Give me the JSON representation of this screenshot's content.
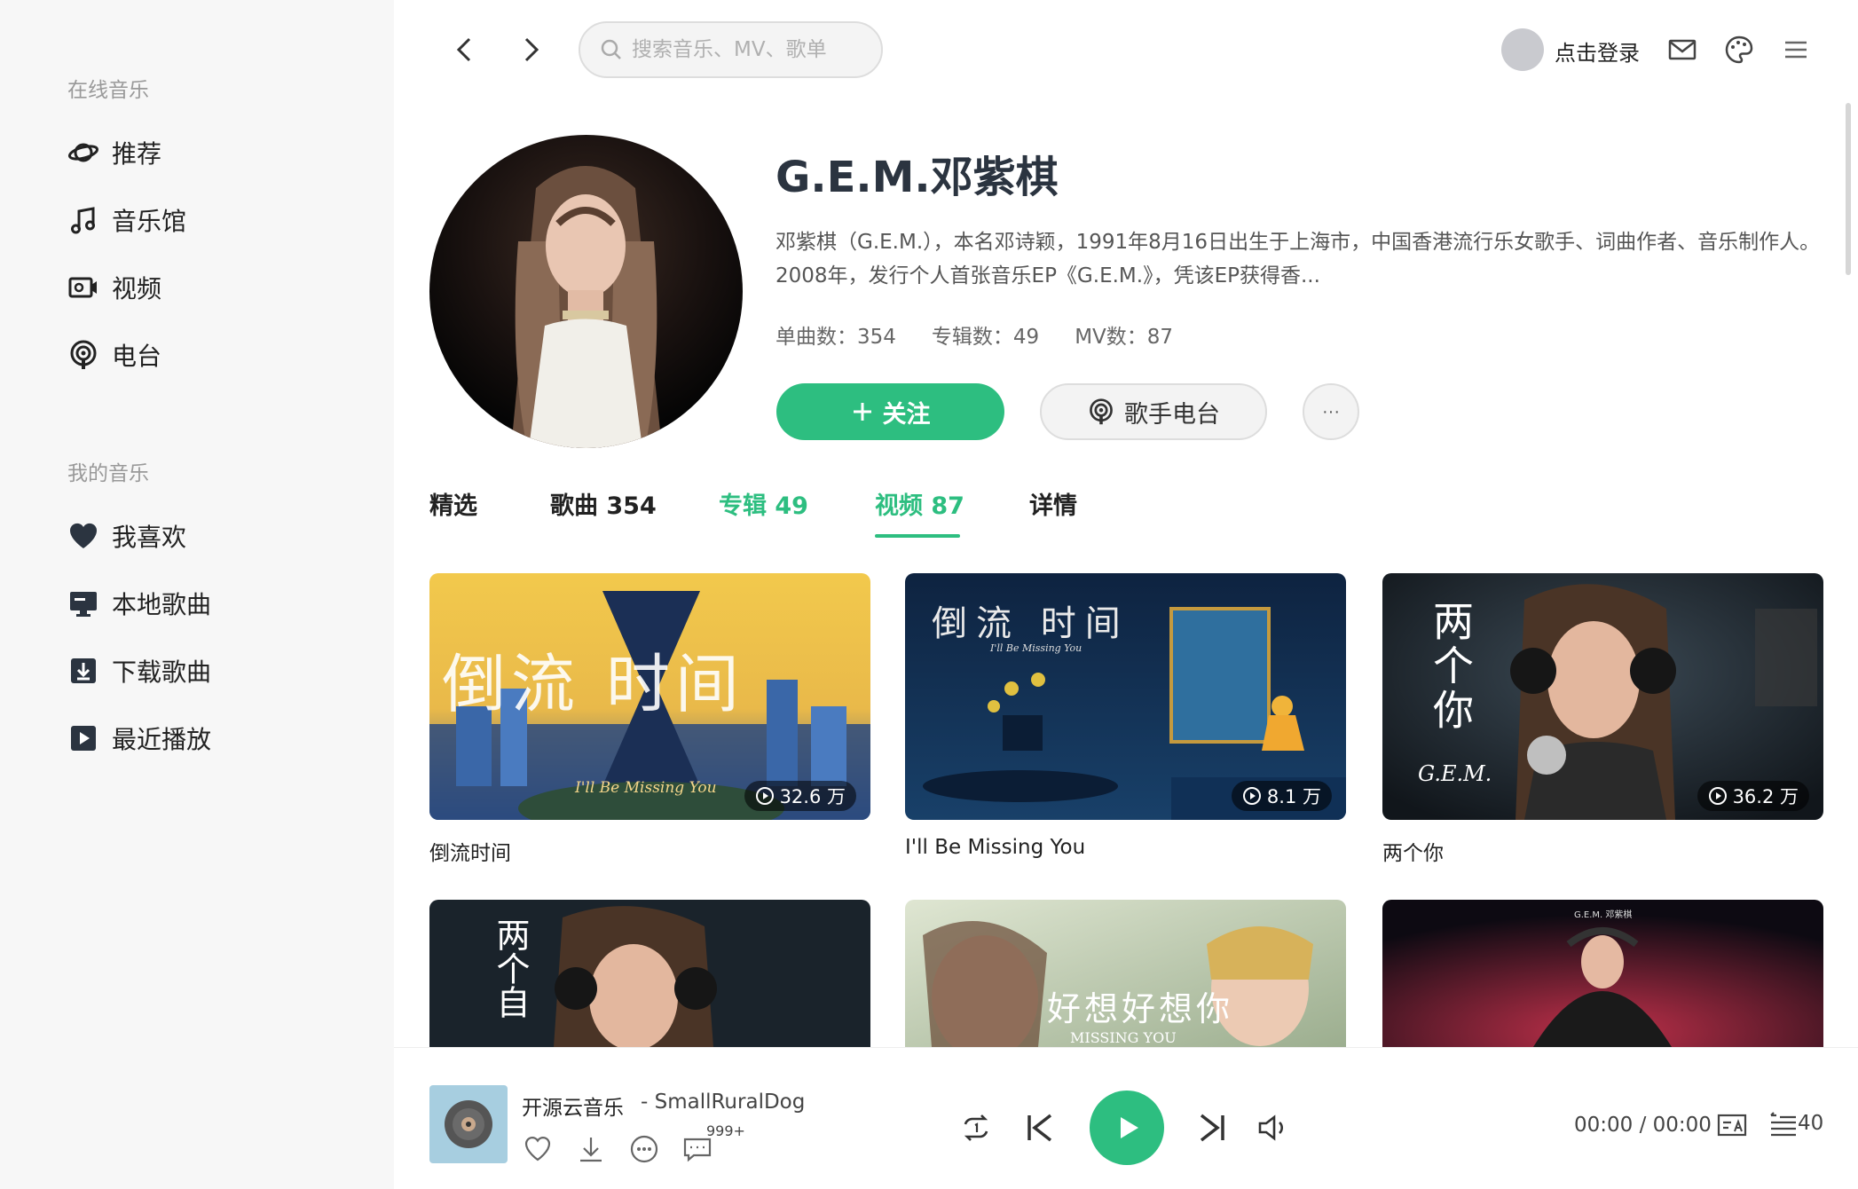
{
  "sidebar": {
    "online_section": "在线音乐",
    "online_items": [
      {
        "label": "推荐",
        "icon": "planet-icon"
      },
      {
        "label": "音乐馆",
        "icon": "music-note-icon"
      },
      {
        "label": "视频",
        "icon": "video-icon"
      },
      {
        "label": "电台",
        "icon": "radio-icon"
      }
    ],
    "my_section": "我的音乐",
    "my_items": [
      {
        "label": "我喜欢",
        "icon": "heart-icon"
      },
      {
        "label": "本地歌曲",
        "icon": "monitor-icon"
      },
      {
        "label": "下载歌曲",
        "icon": "download-icon"
      },
      {
        "label": "最近播放",
        "icon": "play-square-icon"
      }
    ]
  },
  "topbar": {
    "search_placeholder": "搜索音乐、MV、歌单",
    "login_label": "点击登录"
  },
  "artist": {
    "name": "G.E.M.邓紫棋",
    "description": "邓紫棋（G.E.M.），本名邓诗颖，1991年8月16日出生于上海市，中国香港流行乐女歌手、词曲作者、音乐制作人。2008年，发行个人首张音乐EP《G.E.M.》，凭该EP获得香...",
    "stats": {
      "singles": "单曲数：354",
      "albums": "专辑数：49",
      "mvs": "MV数：87"
    },
    "follow_label": "关注",
    "radio_label": "歌手电台",
    "more_label": "···"
  },
  "tabs": [
    {
      "label": "精选",
      "active": false
    },
    {
      "label": "歌曲 354",
      "active": false
    },
    {
      "label": "专辑 49",
      "active": false
    },
    {
      "label": "视频 87",
      "active": true
    },
    {
      "label": "详情",
      "active": false
    }
  ],
  "videos": [
    {
      "title": "倒流时间",
      "plays": "32.6 万",
      "art_text": "倒流 时间",
      "art_sub": "I'll Be Missing You"
    },
    {
      "title": "I'll Be Missing You",
      "plays": "8.1 万",
      "art_text": "倒流 时间",
      "art_sub": "I'll Be Missing You"
    },
    {
      "title": "两个你",
      "plays": "36.2 万",
      "art_text": "两个你",
      "art_sub": "G.E.M."
    },
    {
      "title": "",
      "plays": "",
      "art_text": "两个自"
    },
    {
      "title": "",
      "plays": "",
      "art_text": "好想好想你",
      "art_sub": "MISSING YOU"
    },
    {
      "title": "",
      "plays": "",
      "art_text": "G.E.M. 邓紫棋"
    }
  ],
  "player": {
    "song_name": "开源云音乐",
    "song_artist": "- SmallRuralDog",
    "comment_badge": "999+",
    "time": "00:00 / 00:00",
    "playlist_count": "40"
  },
  "colors": {
    "accent": "#2dbe80",
    "sidebar_bg": "#f7f7f7",
    "title": "#2b3440"
  }
}
